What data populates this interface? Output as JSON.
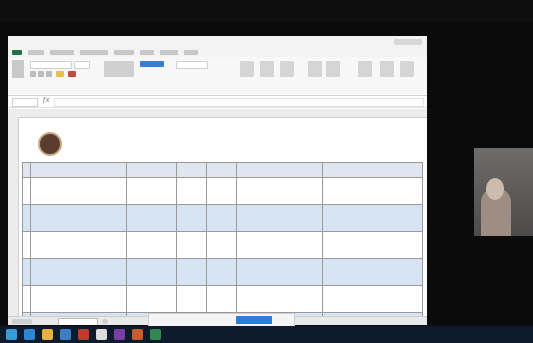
{
  "meeting": {
    "window_title": ""
  },
  "excel": {
    "title": "",
    "name_box": "",
    "formula": "",
    "sheet_tab": "",
    "document": {
      "title": "",
      "subtitle": "",
      "period": ""
    },
    "columns": [
      "",
      "",
      "",
      "",
      "",
      "",
      ""
    ],
    "rows": [
      [
        "",
        "",
        "",
        "",
        "",
        "",
        ""
      ],
      [
        "",
        "",
        "",
        "",
        "",
        "",
        ""
      ],
      [
        "",
        "",
        "",
        "",
        "",
        "",
        ""
      ],
      [
        "",
        "",
        "",
        "",
        "",
        "",
        ""
      ],
      [
        "",
        "",
        "",
        "",
        "",
        "",
        ""
      ],
      [
        "",
        "",
        "",
        "",
        "",
        "",
        ""
      ]
    ]
  },
  "share_bar": {
    "status": "",
    "stop_label": "",
    "hide_label": ""
  },
  "participant": {
    "name": ""
  },
  "taskbar": {
    "tray_text": ""
  },
  "colors": {
    "excel_green": "#217346",
    "share_blue": "#2f7fd3",
    "table_band": "#d6e3f3",
    "taskbar": "#0e1b2d"
  },
  "icons": [
    "windows-start-icon",
    "edge-browser-icon",
    "file-explorer-icon",
    "mail-icon",
    "excel-icon",
    "word-icon",
    "powerpoint-icon",
    "teams-icon",
    "camera-icon",
    "fx-icon"
  ]
}
